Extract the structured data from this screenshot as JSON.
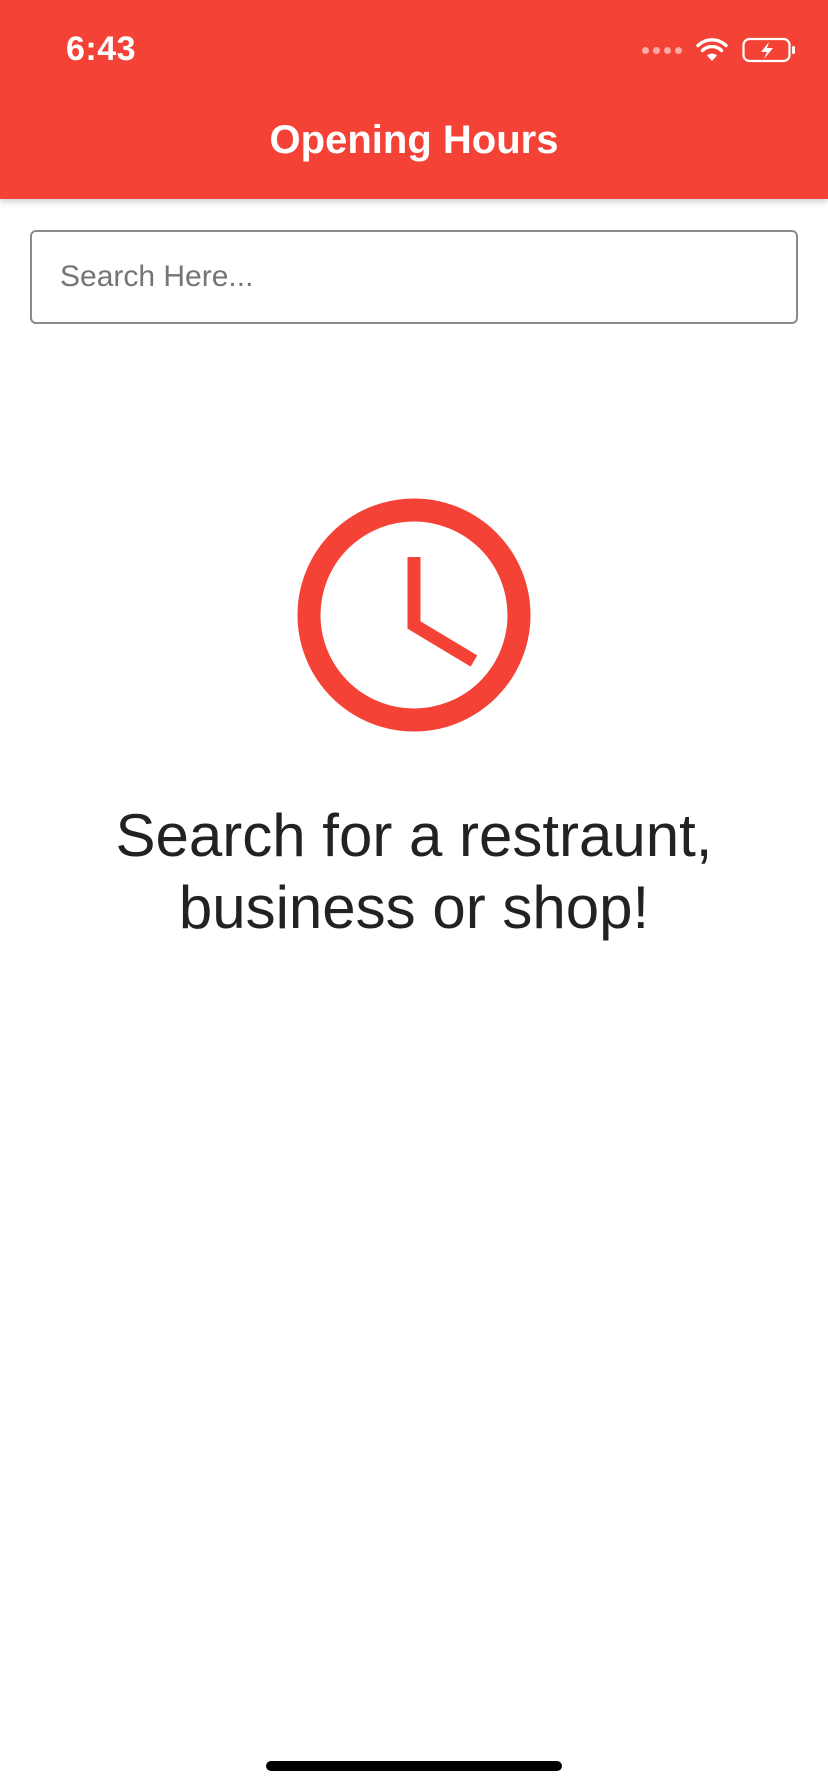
{
  "status_bar": {
    "time": "6:43"
  },
  "app_bar": {
    "title": "Opening Hours"
  },
  "search": {
    "placeholder": "Search Here...",
    "value": ""
  },
  "empty_state": {
    "icon": "clock-icon",
    "message": "Search for a restraunt, business or shop!"
  },
  "colors": {
    "primary": "#f44336",
    "text": "#222222",
    "background": "#ffffff"
  }
}
